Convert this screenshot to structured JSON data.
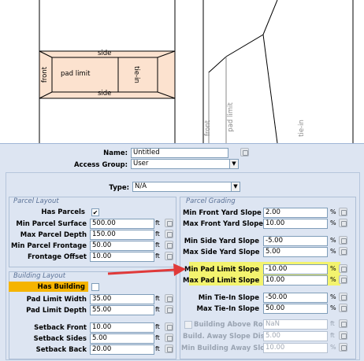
{
  "diagram": {
    "front": "front",
    "side_top": "side",
    "side_bottom": "side",
    "pad_limit": "pad limit",
    "tie_in": "tie-in",
    "front_rot": "front",
    "pad_limit_rot": "pad limit",
    "tie_in_rot": "tie-in"
  },
  "header": {
    "name_label": "Name:",
    "name_value": "Untitled",
    "access_label": "Access Group:",
    "access_value": "User",
    "type_label": "Type:",
    "type_value": "N/A"
  },
  "parcel_layout": {
    "title": "Parcel Layout",
    "has_parcels_label": "Has Parcels",
    "has_parcels_checked": "✔",
    "rows": [
      {
        "label": "Min Parcel Surface",
        "value": "500.00",
        "unit": "ft"
      },
      {
        "label": "Max Parcel Depth",
        "value": "150.00",
        "unit": "ft"
      },
      {
        "label": "Min Parcel Frontage",
        "value": "50.00",
        "unit": "ft"
      },
      {
        "label": "Frontage Offset",
        "value": "10.00",
        "unit": "ft"
      }
    ]
  },
  "building_layout": {
    "title": "Building Layout",
    "has_building_label": "Has Building",
    "rows": [
      {
        "label": "Pad Limit Width",
        "value": "35.00",
        "unit": "ft"
      },
      {
        "label": "Pad Limit Depth",
        "value": "55.00",
        "unit": "ft"
      },
      {
        "label": "Setback Front",
        "value": "10.00",
        "unit": "ft"
      },
      {
        "label": "Setback Sides",
        "value": "5.00",
        "unit": "ft"
      },
      {
        "label": "Setback Back",
        "value": "20.00",
        "unit": "ft"
      }
    ]
  },
  "parcel_grading": {
    "title": "Parcel Grading",
    "rows": [
      {
        "label": "Min Front Yard Slope",
        "value": "2.00",
        "unit": "%"
      },
      {
        "label": "Max Front Yard Slope",
        "value": "10.00",
        "unit": "%"
      },
      {
        "label": "Min Side Yard Slope",
        "value": "-5.00",
        "unit": "%"
      },
      {
        "label": "Max Side Yard Slope",
        "value": "5.00",
        "unit": "%"
      },
      {
        "label": "Min Pad Limit Slope",
        "value": "-10.00",
        "unit": "%"
      },
      {
        "label": "Max Pad Limit Slope",
        "value": "10.00",
        "unit": "%"
      },
      {
        "label": "Min Tie-In Slope",
        "value": "-50.00",
        "unit": "%"
      },
      {
        "label": "Max Tie-In Slope",
        "value": "50.00",
        "unit": "%"
      }
    ],
    "building_above_road_label": "Building Above Road",
    "building_above_road_value": "NaN",
    "building_above_road_unit": "ft",
    "build_away_label": "Build. Away Slope Dist.",
    "build_away_value": "5.00",
    "build_away_unit": "ft",
    "min_building_away_label": "Min Building Away Slope",
    "min_building_away_value": "10.00",
    "min_building_away_unit": "%"
  },
  "colors": {
    "highlight": "#f3f36e",
    "arrow": "#e03a3a",
    "has_building_highlight": "#f5b400",
    "pad_fill": "#f9dcc8"
  }
}
